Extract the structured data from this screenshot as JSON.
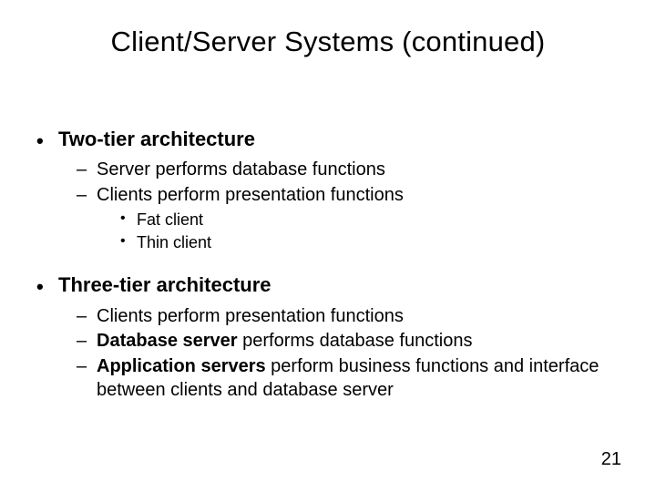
{
  "title": "Client/Server Systems (continued)",
  "l1a": "Two-tier architecture",
  "l1a_sub1": "Server performs database functions",
  "l1a_sub2": "Clients perform presentation functions",
  "l1a_sub2_a": "Fat client",
  "l1a_sub2_b": "Thin client",
  "l1b": "Three-tier architecture",
  "l1b_sub1": "Clients perform presentation functions",
  "l1b_sub2_bold": "Database server",
  "l1b_sub2_rest": " performs database functions",
  "l1b_sub3_bold": "Application servers",
  "l1b_sub3_rest": " perform business functions and interface between clients and database server",
  "page": "21",
  "dash": "–",
  "dot": "•"
}
